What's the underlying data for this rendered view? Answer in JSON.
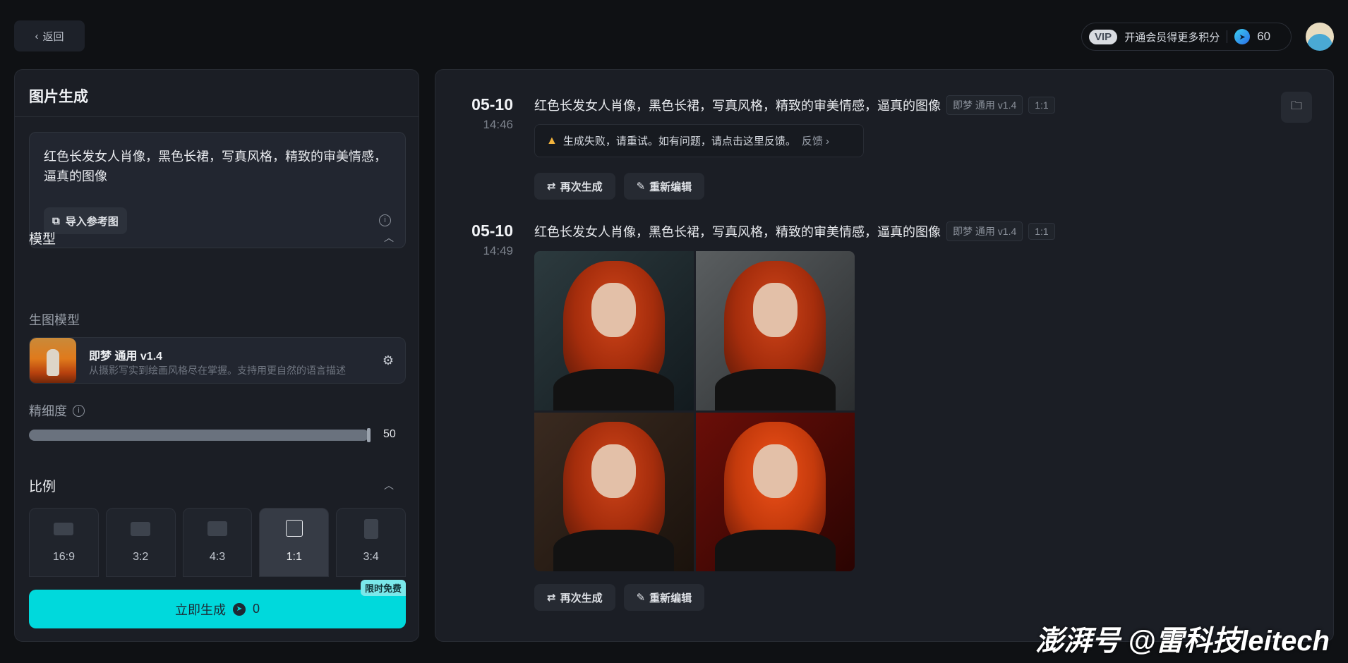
{
  "header": {
    "back_label": "返回",
    "vip_tag": "VIP",
    "vip_text": "开通会员得更多积分",
    "credits": "60"
  },
  "left": {
    "title": "图片生成",
    "prompt": "红色长发女人肖像，黑色长裙，写真风格，精致的审美情感，逼真的图像",
    "import_label": "导入参考图",
    "model_section": "模型",
    "model_sub": "生图模型",
    "model_name": "即梦 通用 v1.4",
    "model_desc": "从摄影写实到绘画风格尽在掌握。支持用更自然的语言描述",
    "detail_label": "精细度",
    "detail_value": "50",
    "detail_fraction": 1.0,
    "ratio_section": "比例",
    "ratios": [
      "16:9",
      "3:2",
      "4:3",
      "1:1",
      "3:4"
    ],
    "selected_ratio": "1:1",
    "generate_label": "立即生成",
    "generate_cost": "0",
    "free_badge": "限时免费"
  },
  "history": [
    {
      "date": "05-10",
      "time": "14:46",
      "prompt": "红色长发女人肖像，黑色长裙，写真风格，精致的审美情感，逼真的图像",
      "model": "即梦 通用 v1.4",
      "ratio": "1:1",
      "error": "生成失败，请重试。如有问题，请点击这里反馈。",
      "feedback": "反馈",
      "regen": "再次生成",
      "reedit": "重新编辑"
    },
    {
      "date": "05-10",
      "time": "14:49",
      "prompt": "红色长发女人肖像，黑色长裙，写真风格，精致的审美情感，逼真的图像",
      "model": "即梦 通用 v1.4",
      "ratio": "1:1",
      "regen": "再次生成",
      "reedit": "重新编辑"
    }
  ],
  "watermark": "澎湃号 @雷科技leitech",
  "colors": {
    "accent": "#00d9dc",
    "bg": "#0f1114",
    "panel": "#1b1e25",
    "warning": "#f2b33c"
  }
}
